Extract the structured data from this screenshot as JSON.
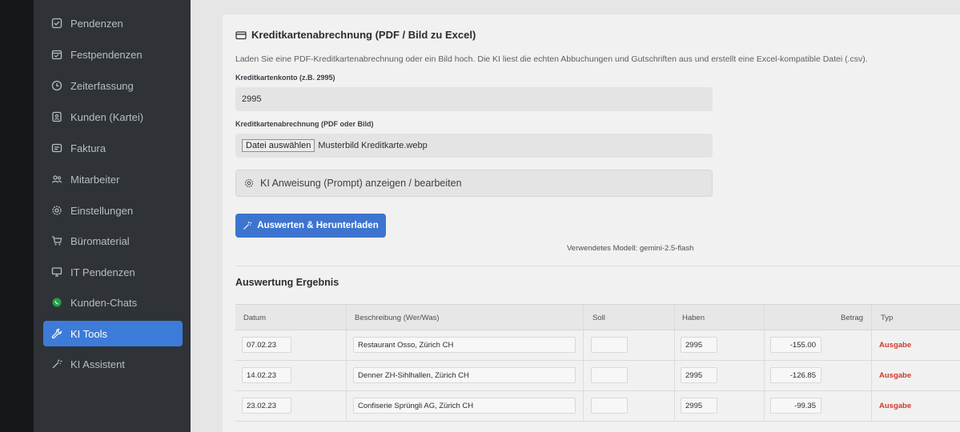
{
  "sidebar": {
    "items": [
      {
        "label": "Pendenzen",
        "icon": "checkbox-icon",
        "active": false
      },
      {
        "label": "Festpendenzen",
        "icon": "calendar-check-icon",
        "active": false
      },
      {
        "label": "Zeiterfassung",
        "icon": "clock-icon",
        "active": false
      },
      {
        "label": "Kunden (Kartei)",
        "icon": "address-card-icon",
        "active": false
      },
      {
        "label": "Faktura",
        "icon": "invoice-icon",
        "active": false
      },
      {
        "label": "Mitarbeiter",
        "icon": "users-icon",
        "active": false
      },
      {
        "label": "Einstellungen",
        "icon": "gear-icon",
        "active": false
      },
      {
        "label": "Büromaterial",
        "icon": "cart-icon",
        "active": false
      },
      {
        "label": "IT Pendenzen",
        "icon": "monitor-icon",
        "active": false
      },
      {
        "label": "Kunden-Chats",
        "icon": "whatsapp-icon",
        "active": false
      },
      {
        "label": "KI Tools",
        "icon": "wrench-icon",
        "active": true
      },
      {
        "label": "KI Assistent",
        "icon": "magic-icon",
        "active": false
      }
    ]
  },
  "main": {
    "title": "Kreditkartenabrechnung (PDF / Bild zu Excel)",
    "description": "Laden Sie eine PDF-Kreditkartenabrechnung oder ein Bild hoch. Die KI liest die echten Abbuchungen und Gutschriften aus und erstellt eine Excel-kompatible Datei (.csv).",
    "account_label": "Kreditkartenkonto (z.B. 2995)",
    "account_value": "2995",
    "file_label": "Kreditkartenabrechnung (PDF oder Bild)",
    "file_button": "Datei auswählen",
    "file_name": "Musterbild Kreditkarte.webp",
    "prompt_label": "KI Anweisung (Prompt) anzeigen / bearbeiten",
    "submit_label": "Auswerten & Herunterladen",
    "model_info": "Verwendetes Modell: gemini-2.5-flash",
    "result_heading": "Auswertung Ergebnis"
  },
  "table": {
    "headers": {
      "datum": "Datum",
      "beschreibung": "Beschreibung (Wer/Was)",
      "soll": "Soll",
      "haben": "Haben",
      "betrag": "Betrag",
      "typ": "Typ"
    },
    "rows": [
      {
        "datum": "07.02.23",
        "beschreibung": "Restaurant Osso, Zürich CH",
        "soll": "",
        "haben": "2995",
        "betrag": "-155.00",
        "typ": "Ausgabe"
      },
      {
        "datum": "14.02.23",
        "beschreibung": "Denner ZH-Sihlhallen, Zürich CH",
        "soll": "",
        "haben": "2995",
        "betrag": "-126.85",
        "typ": "Ausgabe"
      },
      {
        "datum": "23.02.23",
        "beschreibung": "Confiserie Sprüngli AG, Zürich CH",
        "soll": "",
        "haben": "2995",
        "betrag": "-99.35",
        "typ": "Ausgabe"
      }
    ]
  },
  "colors": {
    "accent": "#3d7bd9",
    "sidebar": "#2f3338",
    "expense": "#d03a2a"
  }
}
